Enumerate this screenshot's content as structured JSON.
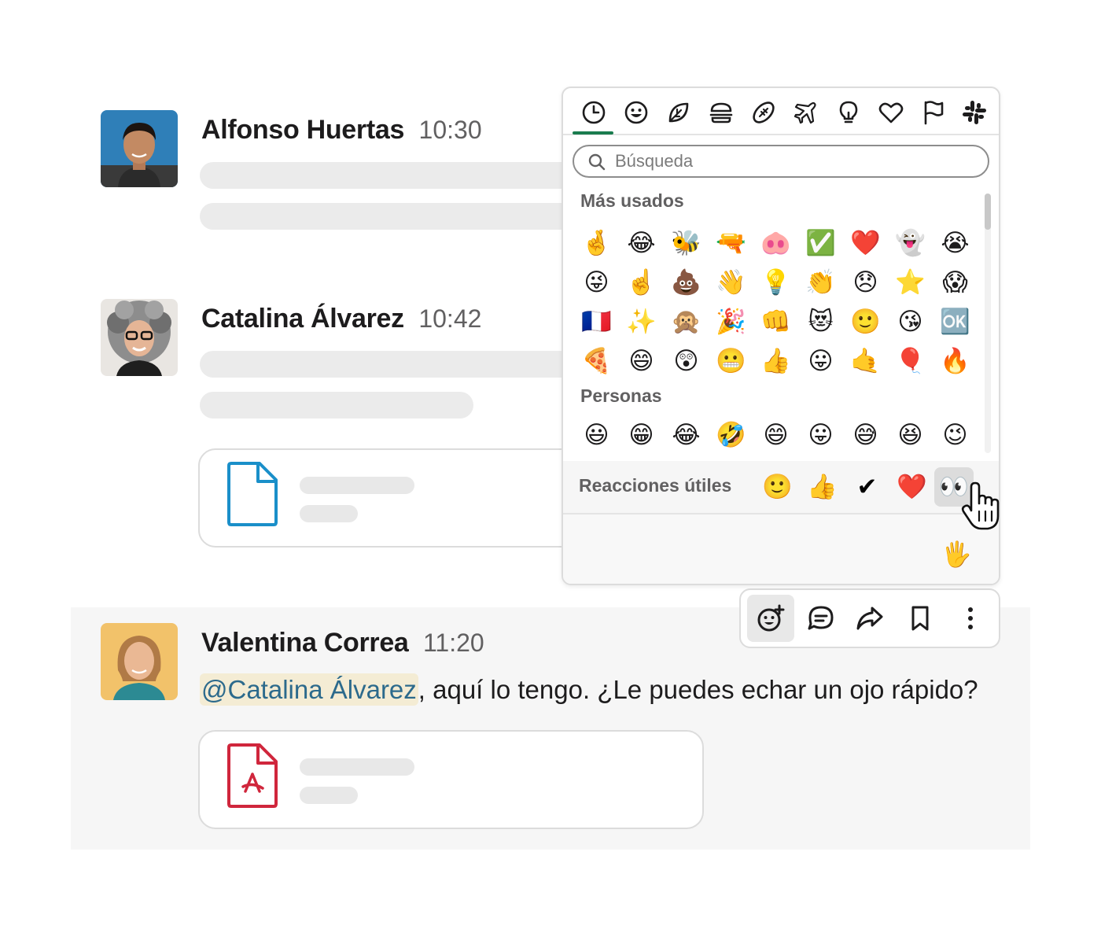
{
  "messages": [
    {
      "author": "Alfonso Huertas",
      "time": "10:30"
    },
    {
      "author": "Catalina Álvarez",
      "time": "10:42"
    },
    {
      "author": "Valentina Correa",
      "time": "11:20",
      "mention": "@Catalina Álvarez",
      "text": ", aquí lo tengo. ¿Le puedes echar un ojo rápido?"
    }
  ],
  "picker": {
    "categories": [
      "recent-icon",
      "smiley-icon",
      "nature-leaf-icon",
      "food-burger-icon",
      "sports-football-icon",
      "travel-plane-icon",
      "objects-bulb-icon",
      "symbols-heart-icon",
      "flags-icon",
      "slack-custom-icon"
    ],
    "active_category": "recent-icon",
    "search_placeholder": "Búsqueda",
    "section_frequent": "Más usados",
    "frequent": [
      "🤞",
      "😂",
      "🐝",
      "🔫",
      "🐽",
      "✅",
      "❤️",
      "👻",
      "😭",
      "😜",
      "☝️",
      "💩",
      "👋",
      "💡",
      "👏",
      "😞",
      "⭐",
      "😱",
      "🇫🇷",
      "✨",
      "🙊",
      "🎉",
      "👊",
      "😻",
      "🙂",
      "😘",
      "🆗",
      "🍕",
      "😄",
      "😲",
      "😬",
      "👍",
      "😛",
      "🤙",
      "🎈",
      "🔥"
    ],
    "section_people": "Personas",
    "people": [
      "😃",
      "😁",
      "😂",
      "🤣",
      "😄",
      "😛",
      "😅",
      "😆",
      "😉"
    ],
    "useful_label": "Reacciones útiles",
    "useful": [
      "🙂",
      "👍",
      "✔",
      "❤️",
      "👀"
    ],
    "selected_useful": "👀",
    "skin_tone": "🖐️"
  },
  "toolbar": [
    "add-reaction-icon",
    "reply-thread-icon",
    "share-forward-icon",
    "bookmark-icon",
    "more-vertical-icon"
  ],
  "colors": {
    "accent_green": "#1a7c4e",
    "mention_bg": "#f4ecd4",
    "mention_text": "#2c6a8c",
    "pdf_red": "#d0263c",
    "file_blue": "#1a8fc9"
  }
}
